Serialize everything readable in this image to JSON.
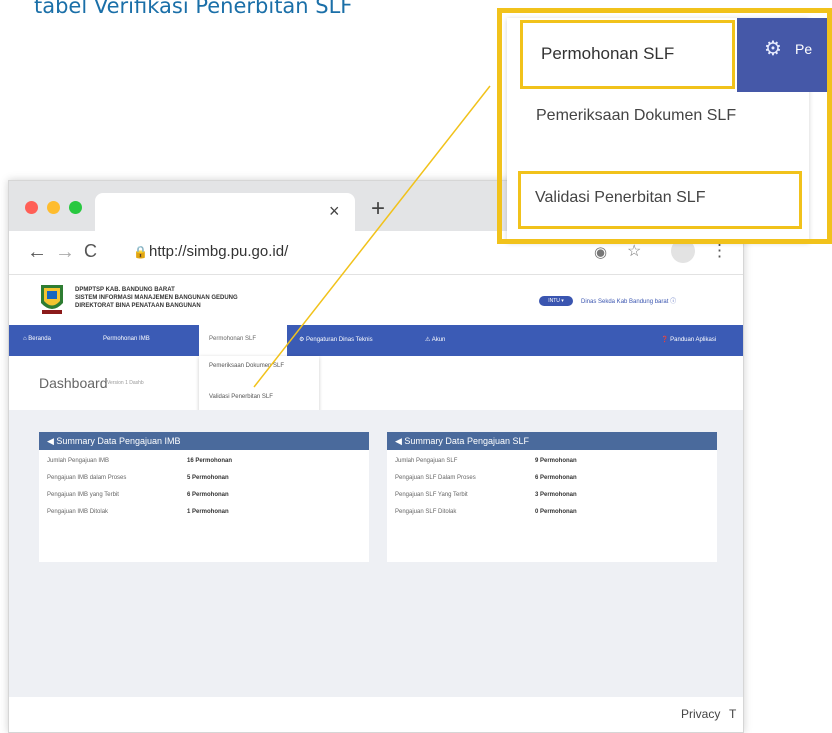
{
  "heading": "tabel Verifikasi Penerbitan SLF",
  "browser": {
    "tab_close": "×",
    "tab_new": "+",
    "url": "http://simbg.pu.go.id/"
  },
  "site": {
    "org_line1": "DPMPTSP KAB. BANDUNG BARAT",
    "org_line2": "SISTEM INFORMASI MANAJEMEN BANGUNAN GEDUNG",
    "org_line3": "DIREKTORAT BINA PENATAAN BANGUNAN",
    "lang_pill": "INTU ▾",
    "lang_text": "Dinas Sekda Kab Bandung barat ⓘ"
  },
  "nav": {
    "items": [
      "⌂ Beranda",
      "Permohonan IMB",
      "Permohonan SLF",
      "⚙ Pengaturan Dinas Teknis",
      "⚠ Akun",
      "❓ Panduan Aplikasi"
    ]
  },
  "dropdown_small": {
    "item1": "Pemeriksaan Dokumen SLF",
    "item2": "Validasi Penerbitan SLF"
  },
  "dashboard": {
    "title": "Dashboard",
    "subtitle": "Version 1 Dashb"
  },
  "panel_imb": {
    "title": "◀ Summary Data Pengajuan IMB",
    "rows": [
      {
        "label": "Jumlah Pengajuan IMB",
        "value": "16 Permohonan"
      },
      {
        "label": "Pengajuan IMB dalam Proses",
        "value": "5 Permohonan"
      },
      {
        "label": "Pengajuan IMB yang Terbit",
        "value": "6 Permohonan"
      },
      {
        "label": "Pengajuan IMB Ditolak",
        "value": "1 Permohonan"
      }
    ]
  },
  "panel_slf": {
    "title": "◀ Summary Data Pengajuan SLF",
    "rows": [
      {
        "label": "Jumlah Pengajuan SLF",
        "value": "9 Permohonan"
      },
      {
        "label": "Pengajuan SLF Dalam Proses",
        "value": "6 Permohonan"
      },
      {
        "label": "Pengajuan SLF Yang Terbit",
        "value": "3 Permohonan"
      },
      {
        "label": "Pengajuan SLF Ditolak",
        "value": "0 Permohonan"
      }
    ]
  },
  "footer": {
    "privacy": "Privacy",
    "t": "T"
  },
  "zoom": {
    "tab_label": "Permohonan SLF",
    "right_text": "Pe",
    "item1": "Pemeriksaan Dokumen SLF",
    "item2": "Validasi Penerbitan SLF"
  },
  "colors": {
    "accent_yellow": "#f1c21b",
    "nav_blue": "#3b5bb5",
    "panel_header": "#4a6a9c",
    "heading_blue": "#1a6fa8"
  }
}
